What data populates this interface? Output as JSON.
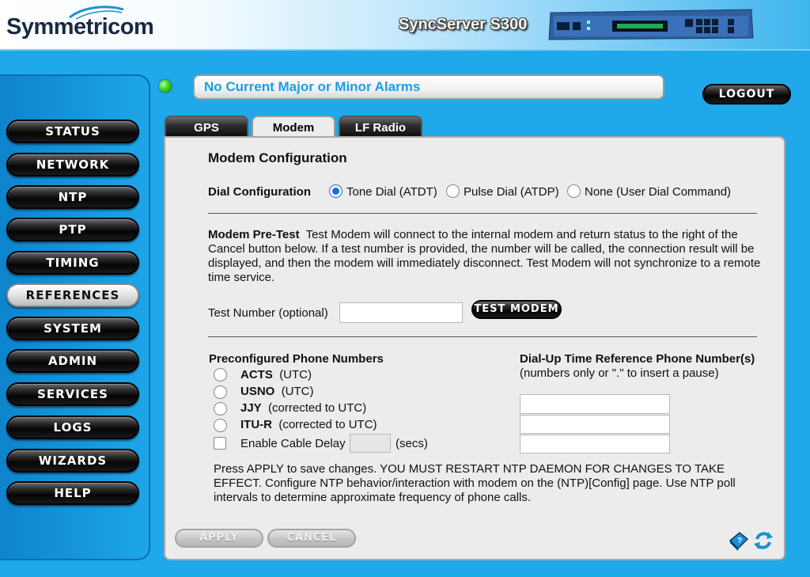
{
  "header": {
    "logo": "Symmetricom",
    "product": "SyncServer S300"
  },
  "alarm": {
    "text": "No Current Major or Minor Alarms",
    "led_color": "#3bd21e"
  },
  "logout_label": "LOGOUT",
  "sidebar": {
    "items": [
      {
        "label": "STATUS",
        "active": false
      },
      {
        "label": "NETWORK",
        "active": false
      },
      {
        "label": "NTP",
        "active": false
      },
      {
        "label": "PTP",
        "active": false
      },
      {
        "label": "TIMING",
        "active": false
      },
      {
        "label": "REFERENCES",
        "active": true
      },
      {
        "label": "SYSTEM",
        "active": false
      },
      {
        "label": "ADMIN",
        "active": false
      },
      {
        "label": "SERVICES",
        "active": false
      },
      {
        "label": "LOGS",
        "active": false
      },
      {
        "label": "WIZARDS",
        "active": false
      },
      {
        "label": "HELP",
        "active": false
      }
    ]
  },
  "tabs": [
    {
      "label": "GPS",
      "active": false
    },
    {
      "label": "Modem",
      "active": true
    },
    {
      "label": "LF Radio",
      "active": false
    }
  ],
  "panel": {
    "title": "Modem Configuration",
    "dial": {
      "label": "Dial Configuration",
      "options": [
        "Tone Dial (ATDT)",
        "Pulse Dial (ATDP)",
        "None (User Dial Command)"
      ],
      "selected": "Tone Dial (ATDT)"
    },
    "pretest": {
      "heading": "Modem Pre-Test",
      "text": "Test Modem will connect to the internal modem and return status to the right of the Cancel button below. If a test number is provided, the number will be called, the connection result will be displayed, and then the modem will immediately disconnect. Test Modem will not synchronize to a remote time service.",
      "test_number_label": "Test Number (optional)",
      "test_number_value": "",
      "test_button": "TEST MODEM"
    },
    "preconfigured": {
      "heading": "Preconfigured Phone Numbers",
      "items": [
        {
          "name": "ACTS",
          "note": "(UTC)"
        },
        {
          "name": "USNO",
          "note": "(UTC)"
        },
        {
          "name": "JJY",
          "note": "(corrected to UTC)"
        },
        {
          "name": "ITU-R",
          "note": "(corrected to UTC)"
        }
      ],
      "cable_delay_label": "Enable Cable Delay",
      "cable_delay_value": "",
      "cable_delay_unit": "(secs)"
    },
    "dialup": {
      "heading": "Dial-Up Time Reference Phone Number(s)",
      "subheading": "(numbers only or \".\" to insert a pause)",
      "numbers": [
        "",
        "",
        ""
      ]
    },
    "note": "Press APPLY to save changes. YOU MUST RESTART NTP DAEMON FOR CHANGES TO TAKE EFFECT. Configure NTP behavior/interaction with modem on the (NTP)[Config] page. Use NTP poll intervals to determine approximate frequency of phone calls.",
    "apply_label": "APPLY",
    "cancel_label": "CANCEL"
  }
}
